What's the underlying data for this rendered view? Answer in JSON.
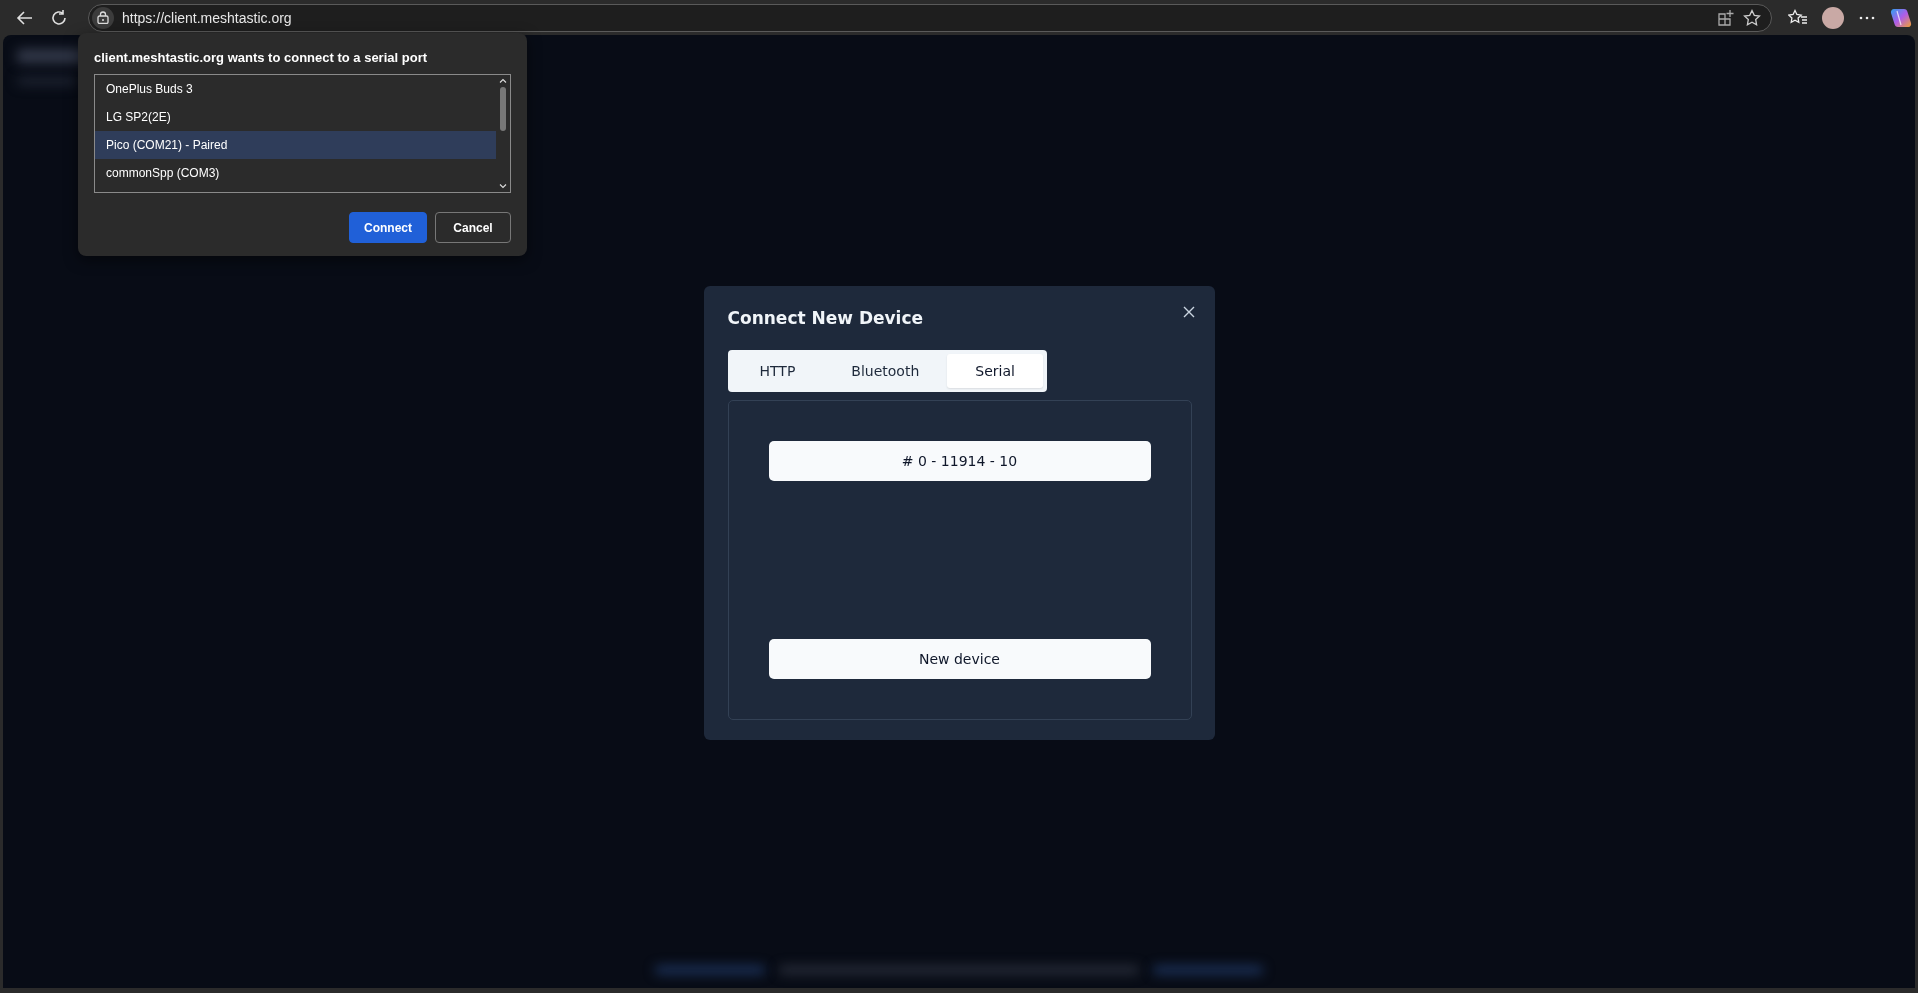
{
  "browser": {
    "url": "https://client.meshtastic.org"
  },
  "serial_prompt": {
    "title": "client.meshtastic.org wants to connect to a serial port",
    "ports": [
      {
        "label": "OnePlus Buds 3",
        "selected": false
      },
      {
        "label": "LG SP2(2E)",
        "selected": false
      },
      {
        "label": "Pico (COM21) - Paired",
        "selected": true
      },
      {
        "label": "commonSpp (COM3)",
        "selected": false
      }
    ],
    "buttons": [
      {
        "label": "Connect",
        "kind": "primary"
      },
      {
        "label": "Cancel",
        "kind": "secondary"
      }
    ]
  },
  "dialog": {
    "title": "Connect New Device",
    "tabs": [
      {
        "label": "HTTP",
        "selected": false
      },
      {
        "label": "Bluetooth",
        "selected": false
      },
      {
        "label": "Serial",
        "selected": true
      }
    ],
    "devices": [
      {
        "label": "# 0 - 11914 - 10"
      }
    ],
    "new_device_button": "New device"
  }
}
